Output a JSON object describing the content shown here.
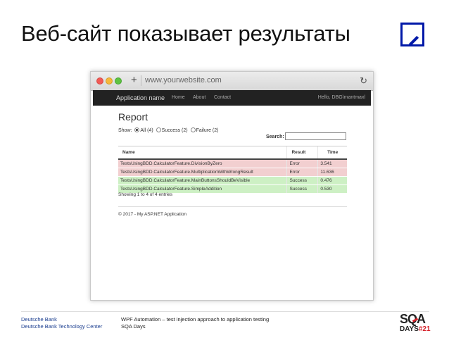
{
  "slide": {
    "title": "Веб-сайт показывает результаты"
  },
  "browser": {
    "url": "www.yourwebsite.com"
  },
  "navbar": {
    "brand": "Application name",
    "links": [
      "Home",
      "About",
      "Contact"
    ],
    "user": "Hello, DBG\\mantmaxl"
  },
  "report": {
    "title": "Report",
    "show_label": "Show:",
    "filters": [
      "All (4)",
      "Success (2)",
      "Failure (2)"
    ],
    "filter_selected": "All (4)",
    "search_label": "Search:",
    "search_value": "",
    "columns": [
      "Name",
      "Result",
      "Time"
    ],
    "rows": [
      {
        "name": "TestsUsingBDD.CalculatorFeature.DivisionByZero",
        "result": "Error",
        "time": "3.541"
      },
      {
        "name": "TestsUsingBDD.CalculatorFeature.MultiplicationWithWrongResult",
        "result": "Error",
        "time": "11.636"
      },
      {
        "name": "TestsUsingBDD.CalculatorFeature.MainButtonsShouldBeVisible",
        "result": "Success",
        "time": "0.476"
      },
      {
        "name": "TestsUsingBDD.CalculatorFeature.SimpleAddition",
        "result": "Success",
        "time": "0.530"
      }
    ],
    "entries_info": "Showing 1 to 4 of 4 entries",
    "footer": "© 2017 - My ASP.NET Application"
  },
  "footer": {
    "left_line1": "Deutsche Bank",
    "left_line2": "Deutsche Bank Technology Center",
    "mid_line1": "WPF Automation – test injection approach to application testing",
    "mid_line2": "SQA Days",
    "logo_top": "SQA",
    "logo_bottom_text": "DAYS",
    "logo_bottom_num": "#21"
  },
  "colors": {
    "error_row": "#f2cfd0",
    "success_row": "#cdf0c4",
    "navbar": "#222222",
    "db_blue": "#0018a8",
    "sqa_red": "#d6212a"
  }
}
